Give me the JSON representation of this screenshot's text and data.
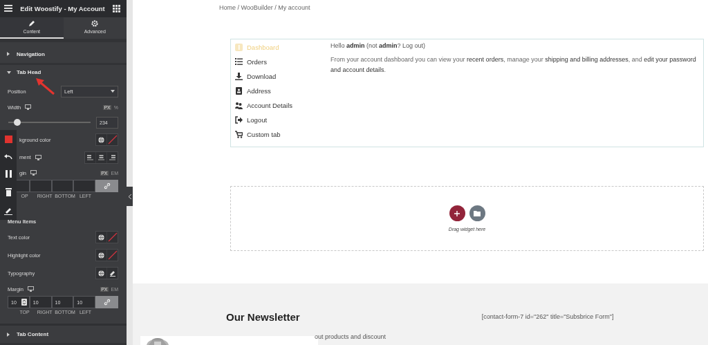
{
  "panel": {
    "title": "Edit Woostify - My Account",
    "tabs": [
      {
        "label": "Content",
        "selected": true
      },
      {
        "label": "Advanced",
        "selected": false
      }
    ],
    "sections": [
      {
        "label": "Navigation",
        "expanded": false
      },
      {
        "label": "Tab Head",
        "expanded": true,
        "controls": [
          {
            "kind": "select",
            "label": "Position",
            "value": "Left"
          },
          {
            "kind": "unit_label",
            "label": "Width",
            "units": [
              {
                "label": "PX",
                "selected": true
              },
              {
                "label": "%",
                "selected": false
              }
            ]
          },
          {
            "kind": "slider",
            "level": 0.11,
            "value": "234"
          },
          {
            "kind": "color",
            "label": "kground color"
          },
          {
            "kind": "align",
            "label": "ment"
          },
          {
            "kind": "unit_label",
            "label": "gin",
            "units": [
              {
                "label": "PX",
                "selected": true
              },
              {
                "label": "EM",
                "selected": false
              }
            ]
          },
          {
            "kind": "dimensions",
            "linked": true,
            "fields": [
              {
                "label": "OP"
              },
              {
                "label": "RIGHT"
              },
              {
                "label": "BOTTOM"
              },
              {
                "label": "LEFT"
              }
            ]
          },
          {
            "kind": "heading",
            "label": "Menu Items"
          },
          {
            "kind": "color",
            "label": "Text color"
          },
          {
            "kind": "color",
            "label": "Highlight color"
          },
          {
            "kind": "typography",
            "label": "Typography"
          },
          {
            "kind": "unit_label",
            "label": "Margin",
            "units": [
              {
                "label": "PX",
                "selected": true
              },
              {
                "label": "EM",
                "selected": false
              }
            ]
          },
          {
            "kind": "dimensions",
            "linked": true,
            "fields": [
              {
                "label": "TOP",
                "value": "10",
                "spinner": true
              },
              {
                "label": "RIGHT",
                "value": "10"
              },
              {
                "label": "BOTTOM",
                "value": "10"
              },
              {
                "label": "LEFT",
                "value": "10"
              }
            ]
          }
        ]
      },
      {
        "label": "Tab Content",
        "expanded": false
      }
    ]
  },
  "page": {
    "breadcrumb": "Home / WooBuilder / My account",
    "account_menu": [
      {
        "label": "Dashboard",
        "selected": true
      },
      {
        "label": "Orders",
        "selected": false
      },
      {
        "label": "Download",
        "selected": false
      },
      {
        "label": "Address",
        "selected": false
      },
      {
        "label": "Account Details",
        "selected": false
      },
      {
        "label": "Logout",
        "selected": false
      },
      {
        "label": "Custom tab",
        "selected": false
      }
    ],
    "greeting": "Hello **admin** (not **admin**? Log out)",
    "description": "From your account dashboard you can view your **recent orders**, manage your **shipping and billing addresses**, and **edit your password and account details**.",
    "drop_zone": {
      "hint": "Drag widget here"
    },
    "footer": {
      "heading": "Our Newsletter",
      "shortcode": "[contact-form-7 id=\"262\" title=\"Subsbrice Form\"]",
      "text": "out products and discount"
    }
  }
}
